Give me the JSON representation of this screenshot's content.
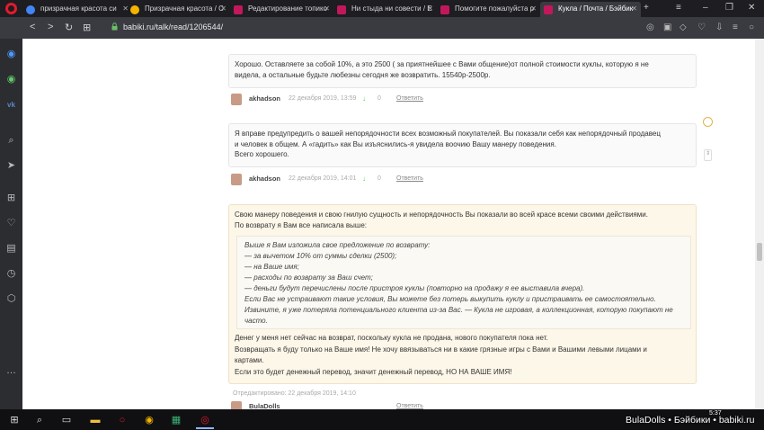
{
  "browser": {
    "tabs": [
      {
        "label": "призрачная красота си",
        "icon": "google-icon",
        "color": "#4285f4"
      },
      {
        "label": "Призрачная красота / С",
        "icon": "chrome-icon",
        "color": "#f4b400"
      },
      {
        "label": "Редактирование топико",
        "icon": "site-icon",
        "color": "#c2185b"
      },
      {
        "label": "Ни стыда ни совести / Е",
        "icon": "site-icon",
        "color": "#c2185b"
      },
      {
        "label": "Помогите пожалуйста р",
        "icon": "site-icon",
        "color": "#c2185b"
      },
      {
        "label": "Кукла / Почта / Бэйбик",
        "icon": "site-icon",
        "color": "#c2185b"
      }
    ],
    "url": "babiki.ru/talk/read/1206544/"
  },
  "comments": {
    "c1": {
      "text_l1": "Хорошо. Оставляете за собой 10%, а это 2500 ( за приятнейшее с Вами общение)от полной стоимости куклы, которую я не",
      "text_l2": "видела, а остальные будьте любезны сегодня же возвратить. 15540р-2500р.",
      "author": "akhadson",
      "date": "22 декабря 2019, 13:59",
      "score": "0",
      "reply": "Ответить"
    },
    "c2": {
      "text_l1": "Я вправе предупредить о вашей непорядочности всех возможный покупателей. Вы показали себя как непорядочный продавец",
      "text_l2": "и человек в общем. А «гадить» как Вы изъяснились-я увидела воочию Вашу манеру поведения.",
      "text_l3": "Всего хорошего.",
      "author": "akhadson",
      "date": "22 декабря 2019, 14:01",
      "score": "0",
      "reply": "Ответить"
    },
    "c3": {
      "intro_l1": "Свою манеру поведения и свою гнилую сущность и непорядочность Вы показали во всей красе всеми своими действиями.",
      "intro_l2": "По возврату я Вам все написала выше:",
      "quote_l1": "Выше я Вам изложила свое предложение по возврату:",
      "quote_l2": "— за вычетом 10% от суммы сделки (2500);",
      "quote_l3": "— на Ваше имя;",
      "quote_l4": "— расходы по возврату за Ваш счет;",
      "quote_l5": "— деньги будут перечислены после пристроя куклы (повторно на продажу я ее выставила вчера).",
      "quote_l6": "Если Вас не устраивают такие условия, Вы можете без потерь выкупить куклу и пристраивать ее самостоятельно.",
      "quote_l7": "Извините, я уже потеряла потенциального клиента из-за Вас. — Кукла не игровая, а коллекционная, которую покупают не",
      "quote_l8": "часто.",
      "outro_l1": "Денег у меня нет сейчас на возврат, поскольку кукла не продана, нового покупателя пока нет.",
      "outro_l2": "Возвращать я буду только на Ваше имя! Не хочу ввязываться ни в какие грязные игры с Вами и Вашими левыми лицами и",
      "outro_l3": "картами.",
      "outro_l4": "Если это будет денежный перевод, значит денежный перевод, НО НА ВАШЕ ИМЯ!",
      "edited": "Отредактировано: 22 декабря 2019, 14:10",
      "author": "BulaDolls",
      "reply": "Ответить"
    }
  },
  "taskbar": {
    "time": "5:37",
    "watermark": "BulaDolls • Бэйбики • babiki.ru"
  }
}
